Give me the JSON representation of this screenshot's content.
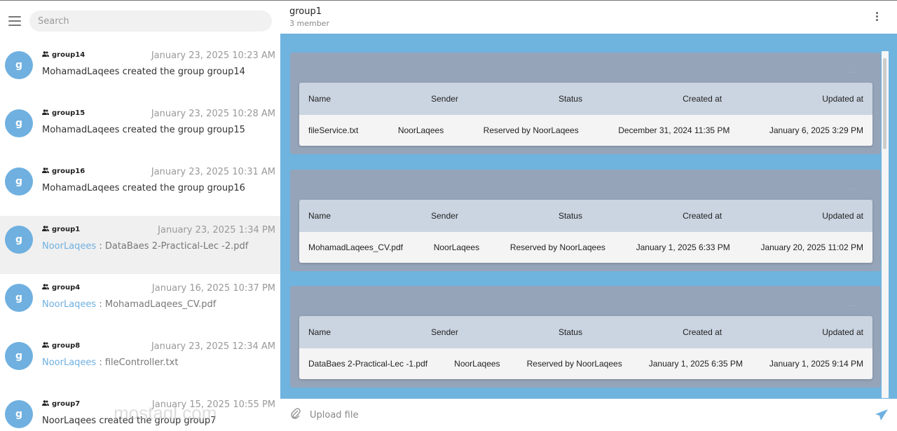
{
  "sidebar": {
    "search_placeholder": "Search",
    "chats": [
      {
        "avatar": "g",
        "name": "group14",
        "time": "January 23, 2025 10:23 AM",
        "message": "MohamadLaqees created the group group14",
        "sender": "",
        "active": false
      },
      {
        "avatar": "g",
        "name": "group15",
        "time": "January 23, 2025 10:28 AM",
        "message": "MohamadLaqees created the group group15",
        "sender": "",
        "active": false
      },
      {
        "avatar": "g",
        "name": "group16",
        "time": "January 23, 2025 10:31 AM",
        "message": "MohamadLaqees created the group group16",
        "sender": "",
        "active": false
      },
      {
        "avatar": "g",
        "name": "group1",
        "time": "January 23, 2025 1:34 PM",
        "message": " : DataBaes 2-Practical-Lec -2.pdf",
        "sender": "NoorLaqees",
        "active": true
      },
      {
        "avatar": "g",
        "name": "group4",
        "time": "January 16, 2025 10:37 PM",
        "message": " : MohamadLaqees_CV.pdf",
        "sender": "NoorLaqees",
        "active": false
      },
      {
        "avatar": "g",
        "name": "group8",
        "time": "January 23, 2025 12:34 AM",
        "message": " : fileController.txt",
        "sender": "NoorLaqees",
        "active": false
      },
      {
        "avatar": "g",
        "name": "group7",
        "time": "January 15, 2025 10:55 PM",
        "message": "NoorLaqees created the group group7",
        "sender": "",
        "active": false
      }
    ]
  },
  "header": {
    "title": "group1",
    "subtitle": "3 member"
  },
  "table_headers": [
    "Name",
    "Sender",
    "Status",
    "Created at",
    "Updated at"
  ],
  "messages": [
    {
      "menu": "...",
      "row": [
        "fileService.txt",
        "NoorLaqees",
        "Reserved by NoorLaqees",
        "December 31, 2024 11:35 PM",
        "January 6, 2025 3:29 PM"
      ]
    },
    {
      "menu": "...",
      "row": [
        "MohamadLaqees_CV.pdf",
        "NoorLaqees",
        "Reserved by NoorLaqees",
        "January 1, 2025 6:33 PM",
        "January 20, 2025 11:02 PM"
      ]
    },
    {
      "menu": "...",
      "row": [
        "DataBaes 2-Practical-Lec -1.pdf",
        "NoorLaqees",
        "Reserved by NoorLaqees",
        "January 1, 2025 6:35 PM",
        "January 1, 2025 9:14 PM"
      ]
    }
  ],
  "footer": {
    "upload_label": "Upload file"
  },
  "watermark": "mostaql.com",
  "colors": {
    "accent": "#6fb0e0",
    "chat_bg": "#6fb3df",
    "card_bg": "#95a4b9"
  }
}
